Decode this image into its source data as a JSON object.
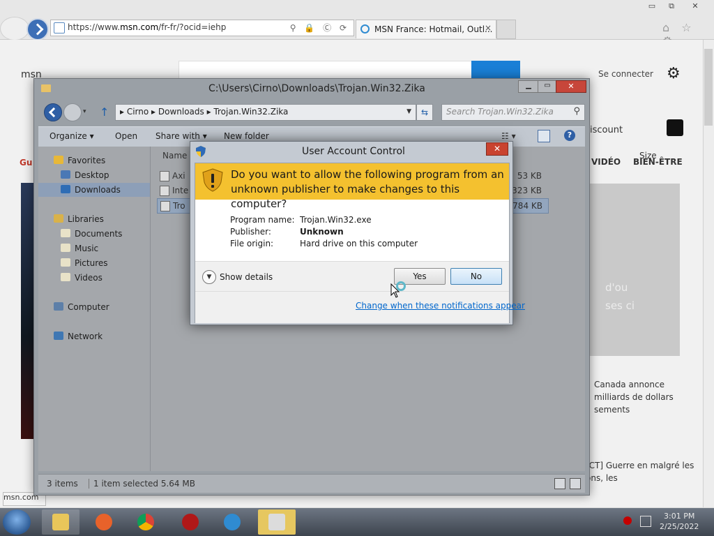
{
  "ie": {
    "url_prefix": "https://www.",
    "url_host": "msn.com",
    "url_rest": "/fr-fr/?ocid=iehp",
    "address_icons": "⚲ 🔒 Ⓒ ⟳",
    "tab_title": "MSN France: Hotmail, Outl...",
    "tab_close": "×",
    "window_controls": {
      "min": "▭",
      "max": "⧉",
      "close": "✕"
    },
    "right_icons": "⌂ ☆ ⚙"
  },
  "msn": {
    "logo": "msn",
    "signin": "Se connecter",
    "discount": "iscount",
    "nav_video": "VIDÉO",
    "nav_bien": "BIEN-ÊTRE",
    "gu_label": "Gu",
    "hero_text": "d'ou\nses ci",
    "news1": "Canada annonce milliards de dollars sements",
    "news2": "[CT] Guerre en malgré les ons, les",
    "footer_link": "msn.com"
  },
  "explorer": {
    "title": "C:\\Users\\Cirno\\Downloads\\Trojan.Win32.Zika",
    "path": "▸ Cirno ▸ Downloads ▸ Trojan.Win32.Zika",
    "search_placeholder": "Search Trojan.Win32.Zika",
    "toolbar": {
      "organize": "Organize ▾",
      "open": "Open",
      "share": "Share with ▾",
      "new_folder": "New folder"
    },
    "sidebar": [
      {
        "label": "Favorites",
        "color": "#e8b838"
      },
      {
        "label": "Desktop",
        "color": "#4a78b5"
      },
      {
        "label": "Downloads",
        "color": "#2f6db5"
      },
      {
        "label": "Libraries",
        "color": "#d9b24a"
      },
      {
        "label": "Documents",
        "color": "#e8e2c8"
      },
      {
        "label": "Music",
        "color": "#e8e2c8"
      },
      {
        "label": "Pictures",
        "color": "#e8e2c8"
      },
      {
        "label": "Videos",
        "color": "#e8e2c8"
      },
      {
        "label": "Computer",
        "color": "#5d7fa8"
      },
      {
        "label": "Network",
        "color": "#3f77b3"
      }
    ],
    "columns": {
      "name": "Name",
      "size": "Size"
    },
    "files": [
      {
        "name": "Axi",
        "size": "53 KB"
      },
      {
        "name": "Inte",
        "size": "323 KB"
      },
      {
        "name": "Tro",
        "size": "5,784 KB"
      }
    ],
    "status": {
      "count": "3 items",
      "selected": "1 item selected  5.64 MB"
    }
  },
  "uac": {
    "title": "User Account Control",
    "close": "✕",
    "question": "Do you want to allow the following program from an unknown publisher to make changes to this computer?",
    "program_label": "Program name:",
    "program_value": "Trojan.Win32.exe",
    "publisher_label": "Publisher:",
    "publisher_value": "Unknown",
    "origin_label": "File origin:",
    "origin_value": "Hard drive on this computer",
    "show_details": "Show details",
    "yes": "Yes",
    "no": "No",
    "change_link": "Change when these notifications appear",
    "banner_color": "#f4c12f"
  },
  "taskbar": {
    "apps": [
      {
        "name": "explorer",
        "color": "#e9c65a"
      },
      {
        "name": "firefox",
        "color": "#e8622a"
      },
      {
        "name": "chrome",
        "color": "#d9a020"
      },
      {
        "name": "opera",
        "color": "#b01818"
      },
      {
        "name": "ie",
        "color": "#2f8bd1"
      },
      {
        "name": "trojan",
        "color": "#dcdcdc"
      }
    ],
    "time": "3:01 PM",
    "date": "2/25/2022"
  }
}
